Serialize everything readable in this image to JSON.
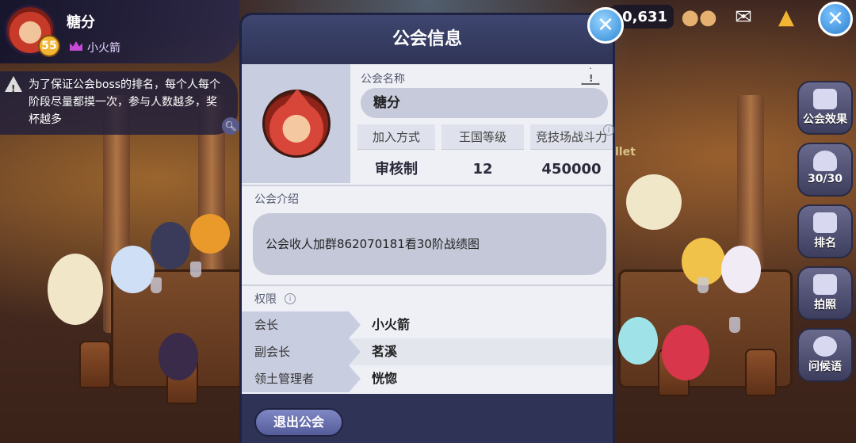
{
  "player": {
    "name": "糖分",
    "level": "55",
    "guild_name": "小火箭"
  },
  "tip": {
    "text": "为了保证公会boss的排名，每个人每个阶段尽量都摸一次，参与人数越多，奖杯越多"
  },
  "topbar": {
    "currency_value": "0,631"
  },
  "side_menu": [
    {
      "label": "公会效果",
      "icon": "house-icon"
    },
    {
      "label": "30/30",
      "icon": "person-icon"
    },
    {
      "label": "排名",
      "icon": "podium-icon"
    },
    {
      "label": "拍照",
      "icon": "camera-icon"
    },
    {
      "label": "问候语",
      "icon": "chat-gear-icon"
    }
  ],
  "modal": {
    "title": "公会信息",
    "guild_name_label": "公会名称",
    "guild_name_value": "糖分",
    "stats": {
      "headers": [
        "加入方式",
        "王国等级",
        "竞技场战斗力"
      ],
      "values": [
        "审核制",
        "12",
        "450000"
      ]
    },
    "intro_label": "公会介绍",
    "intro_text": "公会收人加群862070181看30阶战绩图",
    "permissions_label": "权限",
    "permissions": [
      {
        "role": "会长",
        "name": "小火箭"
      },
      {
        "role": "副会长",
        "name": "茗溪"
      },
      {
        "role": "领土管理者",
        "name": "恍惚"
      }
    ],
    "leave_button": "退出公会"
  },
  "bg_text": {
    "partial_name": "llet"
  }
}
